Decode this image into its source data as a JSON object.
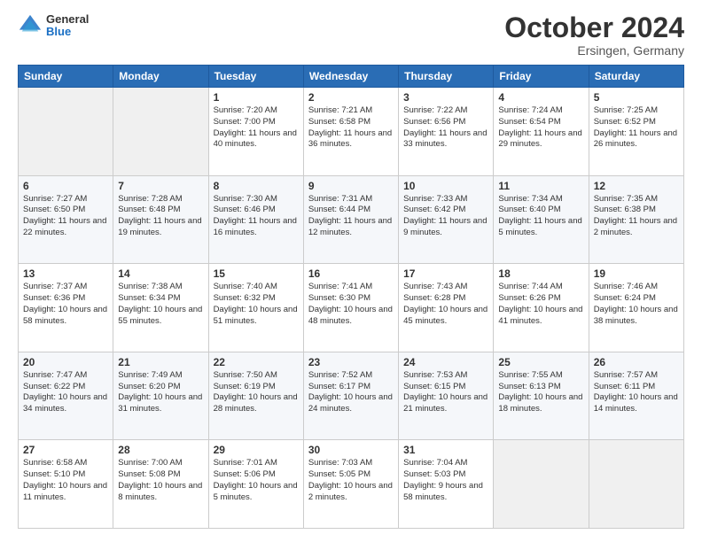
{
  "header": {
    "logo": {
      "general": "General",
      "blue": "Blue"
    },
    "month": "October 2024",
    "location": "Ersingen, Germany"
  },
  "weekdays": [
    "Sunday",
    "Monday",
    "Tuesday",
    "Wednesday",
    "Thursday",
    "Friday",
    "Saturday"
  ],
  "weeks": [
    [
      {
        "day": "",
        "content": ""
      },
      {
        "day": "",
        "content": ""
      },
      {
        "day": "1",
        "content": "Sunrise: 7:20 AM\nSunset: 7:00 PM\nDaylight: 11 hours\nand 40 minutes."
      },
      {
        "day": "2",
        "content": "Sunrise: 7:21 AM\nSunset: 6:58 PM\nDaylight: 11 hours\nand 36 minutes."
      },
      {
        "day": "3",
        "content": "Sunrise: 7:22 AM\nSunset: 6:56 PM\nDaylight: 11 hours\nand 33 minutes."
      },
      {
        "day": "4",
        "content": "Sunrise: 7:24 AM\nSunset: 6:54 PM\nDaylight: 11 hours\nand 29 minutes."
      },
      {
        "day": "5",
        "content": "Sunrise: 7:25 AM\nSunset: 6:52 PM\nDaylight: 11 hours\nand 26 minutes."
      }
    ],
    [
      {
        "day": "6",
        "content": "Sunrise: 7:27 AM\nSunset: 6:50 PM\nDaylight: 11 hours\nand 22 minutes."
      },
      {
        "day": "7",
        "content": "Sunrise: 7:28 AM\nSunset: 6:48 PM\nDaylight: 11 hours\nand 19 minutes."
      },
      {
        "day": "8",
        "content": "Sunrise: 7:30 AM\nSunset: 6:46 PM\nDaylight: 11 hours\nand 16 minutes."
      },
      {
        "day": "9",
        "content": "Sunrise: 7:31 AM\nSunset: 6:44 PM\nDaylight: 11 hours\nand 12 minutes."
      },
      {
        "day": "10",
        "content": "Sunrise: 7:33 AM\nSunset: 6:42 PM\nDaylight: 11 hours\nand 9 minutes."
      },
      {
        "day": "11",
        "content": "Sunrise: 7:34 AM\nSunset: 6:40 PM\nDaylight: 11 hours\nand 5 minutes."
      },
      {
        "day": "12",
        "content": "Sunrise: 7:35 AM\nSunset: 6:38 PM\nDaylight: 11 hours\nand 2 minutes."
      }
    ],
    [
      {
        "day": "13",
        "content": "Sunrise: 7:37 AM\nSunset: 6:36 PM\nDaylight: 10 hours\nand 58 minutes."
      },
      {
        "day": "14",
        "content": "Sunrise: 7:38 AM\nSunset: 6:34 PM\nDaylight: 10 hours\nand 55 minutes."
      },
      {
        "day": "15",
        "content": "Sunrise: 7:40 AM\nSunset: 6:32 PM\nDaylight: 10 hours\nand 51 minutes."
      },
      {
        "day": "16",
        "content": "Sunrise: 7:41 AM\nSunset: 6:30 PM\nDaylight: 10 hours\nand 48 minutes."
      },
      {
        "day": "17",
        "content": "Sunrise: 7:43 AM\nSunset: 6:28 PM\nDaylight: 10 hours\nand 45 minutes."
      },
      {
        "day": "18",
        "content": "Sunrise: 7:44 AM\nSunset: 6:26 PM\nDaylight: 10 hours\nand 41 minutes."
      },
      {
        "day": "19",
        "content": "Sunrise: 7:46 AM\nSunset: 6:24 PM\nDaylight: 10 hours\nand 38 minutes."
      }
    ],
    [
      {
        "day": "20",
        "content": "Sunrise: 7:47 AM\nSunset: 6:22 PM\nDaylight: 10 hours\nand 34 minutes."
      },
      {
        "day": "21",
        "content": "Sunrise: 7:49 AM\nSunset: 6:20 PM\nDaylight: 10 hours\nand 31 minutes."
      },
      {
        "day": "22",
        "content": "Sunrise: 7:50 AM\nSunset: 6:19 PM\nDaylight: 10 hours\nand 28 minutes."
      },
      {
        "day": "23",
        "content": "Sunrise: 7:52 AM\nSunset: 6:17 PM\nDaylight: 10 hours\nand 24 minutes."
      },
      {
        "day": "24",
        "content": "Sunrise: 7:53 AM\nSunset: 6:15 PM\nDaylight: 10 hours\nand 21 minutes."
      },
      {
        "day": "25",
        "content": "Sunrise: 7:55 AM\nSunset: 6:13 PM\nDaylight: 10 hours\nand 18 minutes."
      },
      {
        "day": "26",
        "content": "Sunrise: 7:57 AM\nSunset: 6:11 PM\nDaylight: 10 hours\nand 14 minutes."
      }
    ],
    [
      {
        "day": "27",
        "content": "Sunrise: 6:58 AM\nSunset: 5:10 PM\nDaylight: 10 hours\nand 11 minutes."
      },
      {
        "day": "28",
        "content": "Sunrise: 7:00 AM\nSunset: 5:08 PM\nDaylight: 10 hours\nand 8 minutes."
      },
      {
        "day": "29",
        "content": "Sunrise: 7:01 AM\nSunset: 5:06 PM\nDaylight: 10 hours\nand 5 minutes."
      },
      {
        "day": "30",
        "content": "Sunrise: 7:03 AM\nSunset: 5:05 PM\nDaylight: 10 hours\nand 2 minutes."
      },
      {
        "day": "31",
        "content": "Sunrise: 7:04 AM\nSunset: 5:03 PM\nDaylight: 9 hours\nand 58 minutes."
      },
      {
        "day": "",
        "content": ""
      },
      {
        "day": "",
        "content": ""
      }
    ]
  ]
}
